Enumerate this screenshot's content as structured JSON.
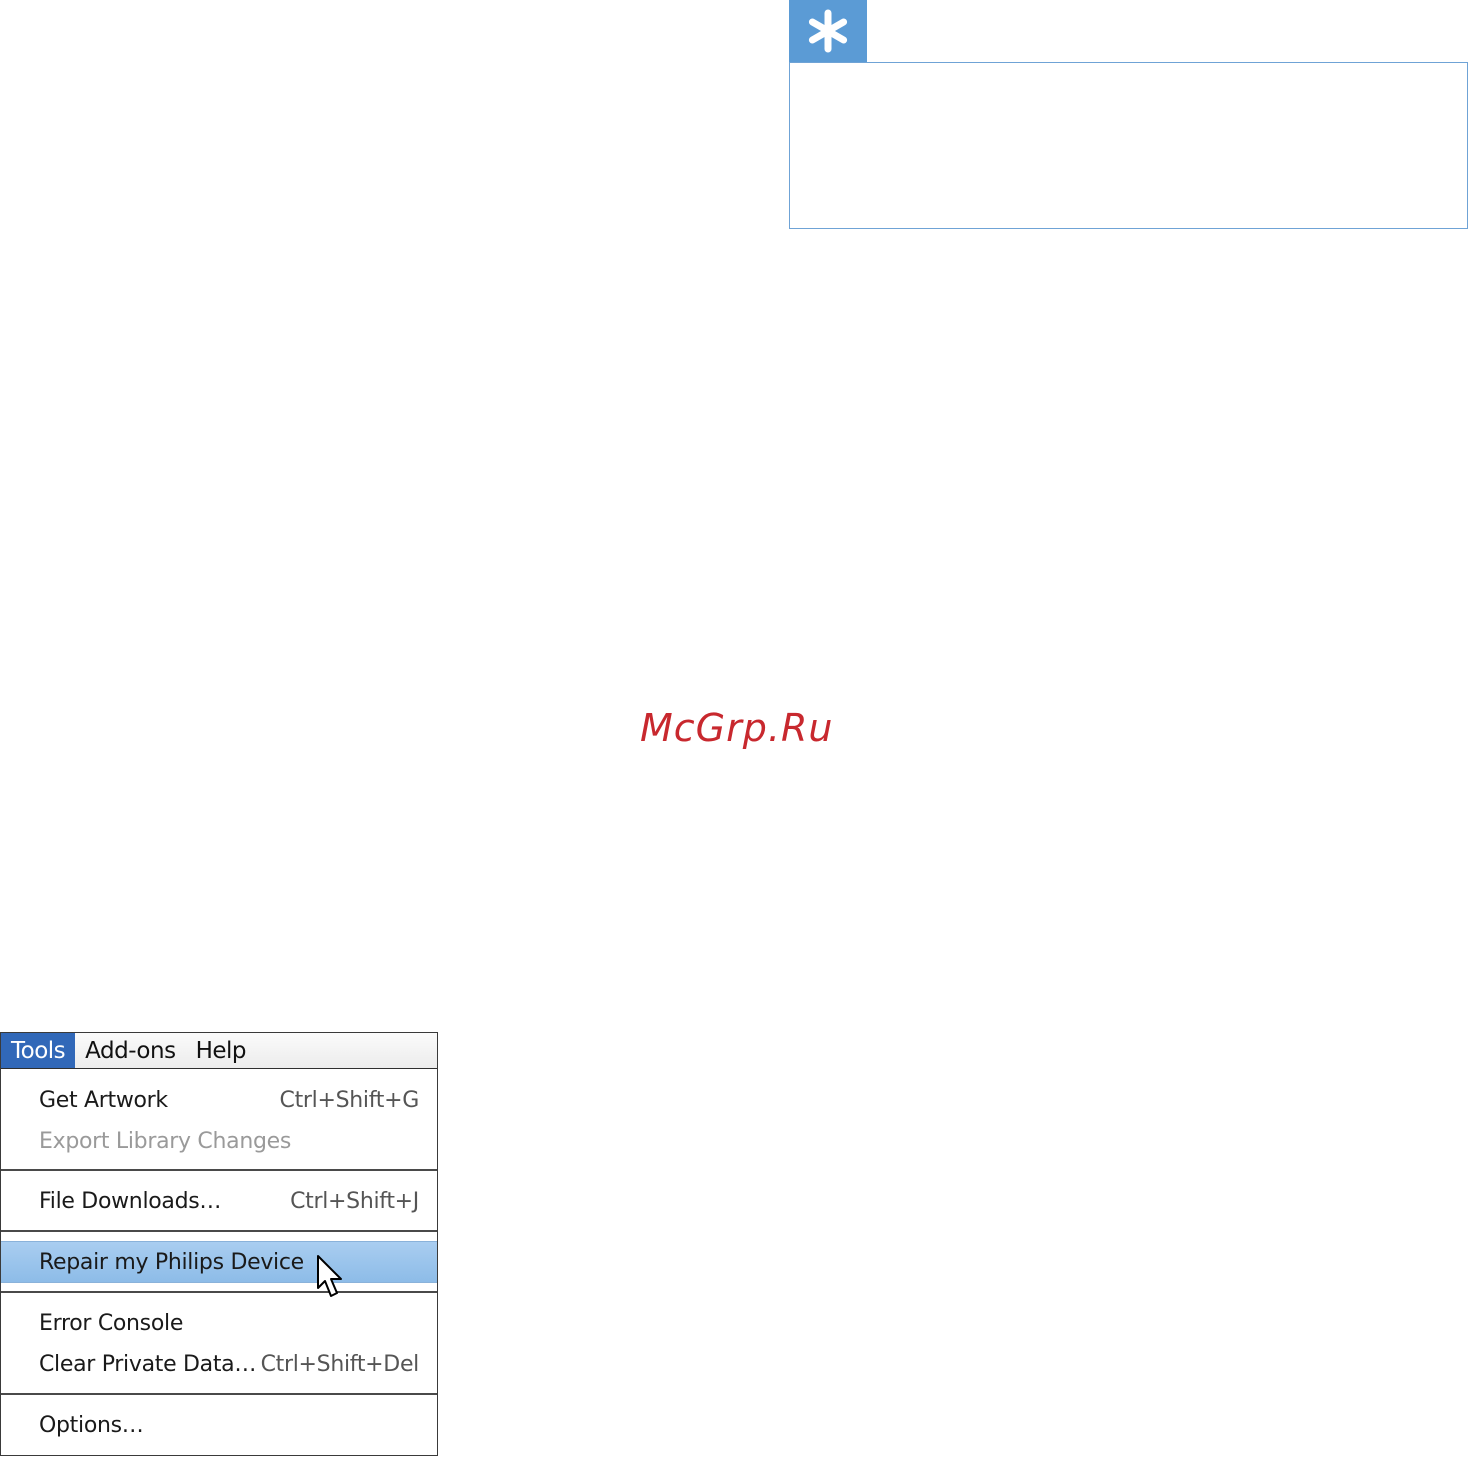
{
  "watermark": "McGrp.Ru",
  "menubar": {
    "items": [
      {
        "label": "Tools",
        "active": true
      },
      {
        "label": "Add-ons",
        "active": false
      },
      {
        "label": "Help",
        "active": false
      }
    ]
  },
  "dropdown": {
    "items": [
      {
        "label": "Get Artwork",
        "shortcut": "Ctrl+Shift+G"
      },
      {
        "label": "Export Library Changes",
        "shortcut": ""
      },
      {
        "label": "File Downloads…",
        "shortcut": "Ctrl+Shift+J"
      },
      {
        "label": "Repair my Philips Device",
        "shortcut": ""
      },
      {
        "label": "Error Console",
        "shortcut": ""
      },
      {
        "label": "Clear Private Data…",
        "shortcut": "Ctrl+Shift+Del"
      },
      {
        "label": "Options…",
        "shortcut": ""
      }
    ]
  },
  "colors": {
    "accent": "#5b9bd5",
    "menu_active": "#3168b8",
    "menu_highlight": "#9cc6ee",
    "watermark": "#c8282e"
  },
  "icons": {
    "tip": "asterisk-icon",
    "cursor": "mouse-pointer-icon"
  }
}
